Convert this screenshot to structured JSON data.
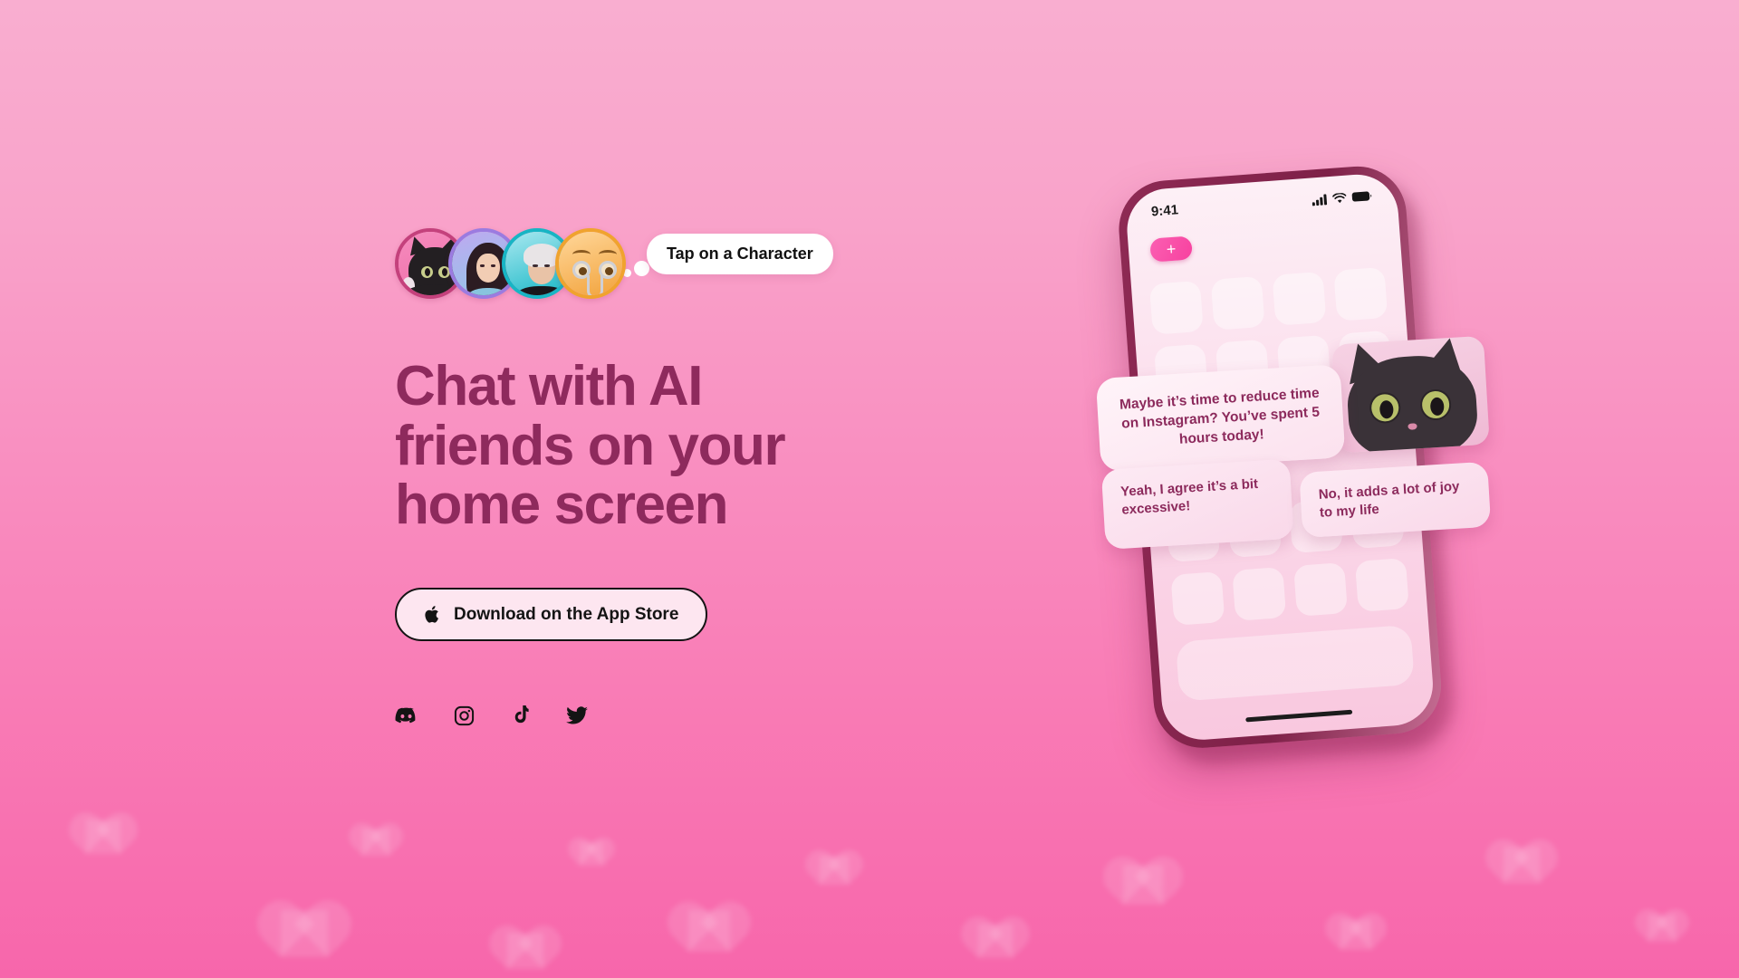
{
  "theme": {
    "bg_top": "#F9AED0",
    "bg_bottom": "#F766AB",
    "headline_color": "#8E2A5D",
    "phone_frame_color": "#8E2A54",
    "accent_pink": "#F7419F"
  },
  "characters": {
    "tooltip": "Tap on a Character",
    "items": [
      {
        "name": "black-cat",
        "ring_color": "#C4417C"
      },
      {
        "name": "long-haired-woman",
        "ring_color": "#9B7BE0"
      },
      {
        "name": "white-haired-man",
        "ring_color": "#17B5C4"
      },
      {
        "name": "robot-emoji",
        "ring_color": "#F0A32E"
      }
    ]
  },
  "hero": {
    "headline_line1": "Chat with AI",
    "headline_line2": "friends on your",
    "headline_line3": "home screen",
    "cta_label": "Download on the App Store",
    "cta_icon": "apple-icon"
  },
  "socials": [
    {
      "name": "discord",
      "label": "Discord"
    },
    {
      "name": "instagram",
      "label": "Instagram"
    },
    {
      "name": "tiktok",
      "label": "TikTok"
    },
    {
      "name": "twitter",
      "label": "Twitter"
    }
  ],
  "phone": {
    "status": {
      "time": "9:41",
      "cellular_icon": "signal-bars-icon",
      "wifi_icon": "wifi-icon",
      "battery_icon": "battery-icon"
    },
    "add_button_label": "+",
    "app_icon_count_top": 8,
    "app_icon_count_bottom": 8
  },
  "chat": {
    "ai_message": "Maybe it’s time to reduce time on Instagram? You’ve spent 5 hours today!",
    "reply_left": "Yeah, I agree it’s a bit excessive!",
    "reply_right": "No, it adds a lot of joy to my life",
    "avatar_name": "black-cat-avatar"
  }
}
